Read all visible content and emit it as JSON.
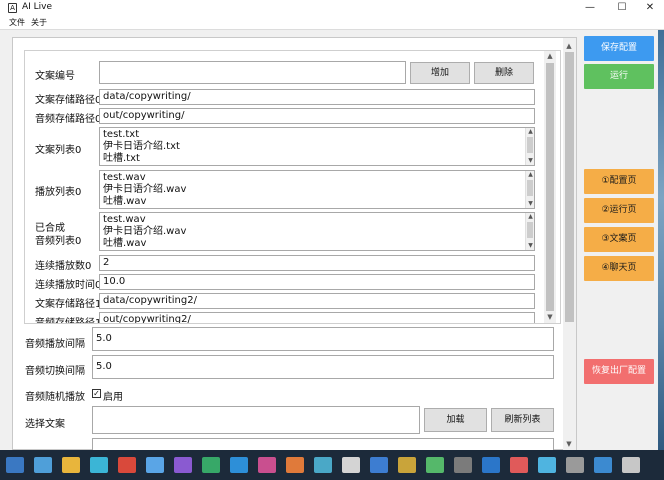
{
  "window": {
    "title": "AI Live",
    "icon_label": "A",
    "controls": {
      "minimize": "—",
      "maximize": "☐",
      "close": "✕"
    }
  },
  "menu": [
    "文件",
    "关于"
  ],
  "config": {
    "copy_id_label": "文案编号",
    "copy_id_value": "",
    "add_button": "增加",
    "delete_button": "删除",
    "copy_path0_label": "文案存储路径0",
    "copy_path0_value": "data/copywriting/",
    "audio_path0_label": "音频存储路径0",
    "audio_path0_value": "out/copywriting/",
    "copy_list0_label": "文案列表0",
    "copy_list0_items": [
      "test.txt",
      "伊卡日语介绍.txt",
      "吐槽.txt"
    ],
    "play_list0_label": "播放列表0",
    "play_list0_items": [
      "test.wav",
      "伊卡日语介绍.wav",
      "吐槽.wav"
    ],
    "synth_list0_label_line1": "已合成",
    "synth_list0_label_line2": "音频列表0",
    "synth_list0_items": [
      "test.wav",
      "伊卡日语介绍.wav",
      "吐槽.wav"
    ],
    "continuous_count0_label": "连续播放数0",
    "continuous_count0_value": "2",
    "continuous_time0_label": "连续播放时间0",
    "continuous_time0_value": "10.0",
    "copy_path1_label": "文案存储路径1",
    "copy_path1_value": "data/copywriting2/",
    "audio_path1_label": "音频存储路径1",
    "audio_path1_value": "out/copywriting2/"
  },
  "settings": {
    "audio_interval_label": "音频播放间隔",
    "audio_interval_value": "5.0",
    "audio_switch_label": "音频切换间隔",
    "audio_switch_value": "5.0",
    "random_play_label": "音频随机播放",
    "random_play_checkbox_label": "启用",
    "random_play_checked": true,
    "select_copy_label": "选择文案",
    "select_copy_value": "",
    "load_button": "加载",
    "refresh_button": "刷新列表"
  },
  "sidebar": {
    "save_button": "保存配置",
    "run_button": "运行",
    "page_config": "①配置页",
    "page_run": "②运行页",
    "page_copy": "③文案页",
    "page_chat": "④聊天页",
    "reset_button": "恢复出厂配置"
  },
  "colors": {
    "save_blue": "#3d9af0",
    "run_green": "#5fc15f",
    "page_orange": "#f5ad47",
    "reset_red": "#f26f6f",
    "taskbar": "#1c2a3a"
  }
}
